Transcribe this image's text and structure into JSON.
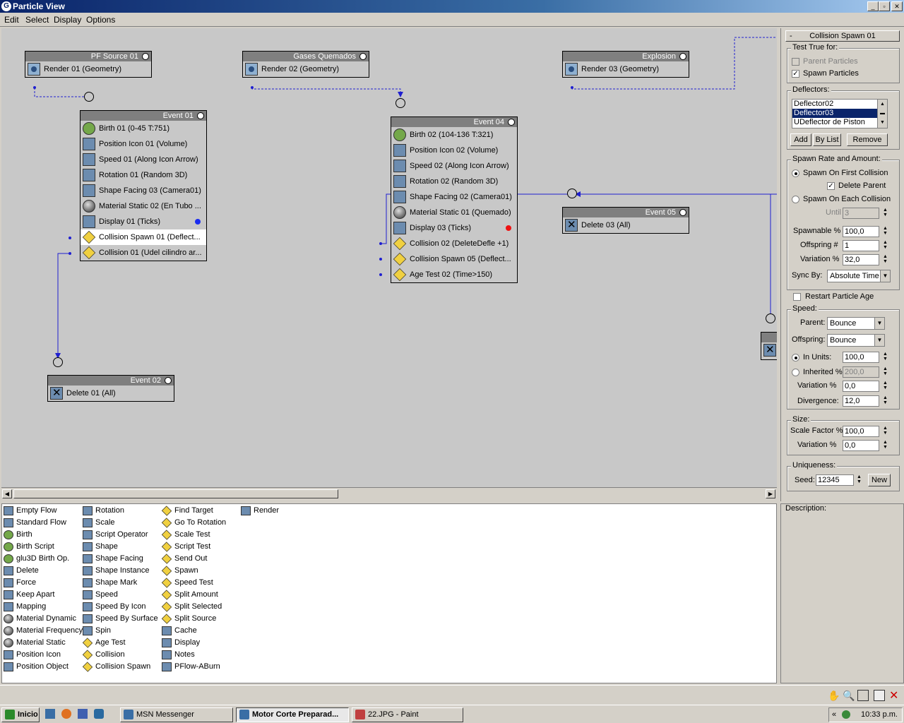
{
  "window": {
    "title": "Particle View"
  },
  "menu": [
    "Edit",
    "Select",
    "Display",
    "Options"
  ],
  "sources": [
    {
      "title": "PF Source 01",
      "op": "Render 01 (Geometry)"
    },
    {
      "title": "Gases Quemados",
      "op": "Render 02 (Geometry)"
    },
    {
      "title": "Explosion",
      "op": "Render 03 (Geometry)"
    }
  ],
  "event01": {
    "title": "Event 01",
    "ops": [
      "Birth 01 (0-45 T:751)",
      "Position Icon 01 (Volume)",
      "Speed 01 (Along Icon Arrow)",
      "Rotation 01 (Random 3D)",
      "Shape Facing 03 (Camera01)",
      "Material Static 02 (En Tubo ...",
      "Display 01 (Ticks)",
      "Collision Spawn 01 (Deflect...",
      "Collision 01 (Udel cilindro ar..."
    ]
  },
  "event02": {
    "title": "Event 02",
    "ops": [
      "Delete 01 (All)"
    ]
  },
  "event04": {
    "title": "Event 04",
    "ops": [
      "Birth 02 (104-136 T:321)",
      "Position Icon 02 (Volume)",
      "Speed 02 (Along Icon Arrow)",
      "Rotation 02 (Random 3D)",
      "Shape Facing 02 (Camera01)",
      "Material Static 01 (Quemado)",
      "Display 03 (Ticks)",
      "Collision 02 (DeleteDefle +1)",
      "Collision Spawn 05 (Deflect...",
      "Age Test 02 (Time>150)"
    ]
  },
  "event05": {
    "title": "Event 05",
    "ops": [
      "Delete 03 (All)"
    ]
  },
  "colors": {
    "display01": "#1a2cf0",
    "display03": "#ee1111",
    "wire": "#1f1fd0"
  },
  "panel": {
    "title": "Collision Spawn 01",
    "collapse": "-",
    "test_true_for": "Test True for:",
    "parent_particles": "Parent Particles",
    "spawn_particles": "Spawn Particles",
    "deflectors_label": "Deflectors:",
    "deflectors": [
      "Deflector02",
      "Deflector03",
      "UDeflector de Piston"
    ],
    "add": "Add",
    "by_list": "By List",
    "remove": "Remove",
    "spawn_rate": "Spawn Rate and Amount:",
    "spawn_first": "Spawn On First Collision",
    "delete_parent": "Delete Parent",
    "spawn_each": "Spawn On Each Collision",
    "until_label": "Until #",
    "until_val": "3",
    "spawnable_label": "Spawnable %",
    "spawnable_val": "100,0",
    "offspring_label": "Offspring #",
    "offspring_val": "1",
    "variation_label": "Variation %",
    "variation_val": "32,0",
    "sync_label": "Sync By:",
    "sync_val": "Absolute Time",
    "restart_age": "Restart Particle Age",
    "speed_label": "Speed:",
    "parent_label": "Parent:",
    "parent_val": "Bounce",
    "offspring2_label": "Offspring:",
    "offspring2_val": "Bounce",
    "in_units": "In Units:",
    "in_units_val": "100,0",
    "inherited": "Inherited %",
    "inherited_val": "200,0",
    "svariation_label": "Variation %",
    "svariation_val": "0,0",
    "divergence_label": "Divergence:",
    "divergence_val": "12,0",
    "size_label": "Size:",
    "scale_label": "Scale Factor %",
    "scale_val": "100,0",
    "zvariation_label": "Variation %",
    "zvariation_val": "0,0",
    "uniqueness_label": "Uniqueness:",
    "seed_label": "Seed:",
    "seed_val": "12345",
    "new": "New",
    "description": "Description:"
  },
  "depot": [
    [
      "Empty Flow",
      "Standard Flow",
      "Birth",
      "Birth Script",
      "glu3D Birth Op.",
      "Delete",
      "Force",
      "Keep Apart",
      "Mapping",
      "Material Dynamic",
      "Material Frequency",
      "Material Static",
      "Position Icon",
      "Position Object"
    ],
    [
      "Rotation",
      "Scale",
      "Script Operator",
      "Shape",
      "Shape Facing",
      "Shape Instance",
      "Shape Mark",
      "Speed",
      "Speed By Icon",
      "Speed By Surface",
      "Spin",
      "Age Test",
      "Collision",
      "Collision Spawn"
    ],
    [
      "Find Target",
      "Go To Rotation",
      "Scale Test",
      "Script Test",
      "Send Out",
      "Spawn",
      "Speed Test",
      "Split Amount",
      "Split Selected",
      "Split Source",
      "Cache",
      "Display",
      "Notes",
      "PFlow-ABurn"
    ],
    [
      "Render"
    ]
  ],
  "taskbar": {
    "start": "Inicio",
    "tasks": [
      "MSN Messenger",
      "Motor Corte Preparad...",
      "22.JPG - Paint"
    ],
    "clock": "10:33 p.m."
  }
}
